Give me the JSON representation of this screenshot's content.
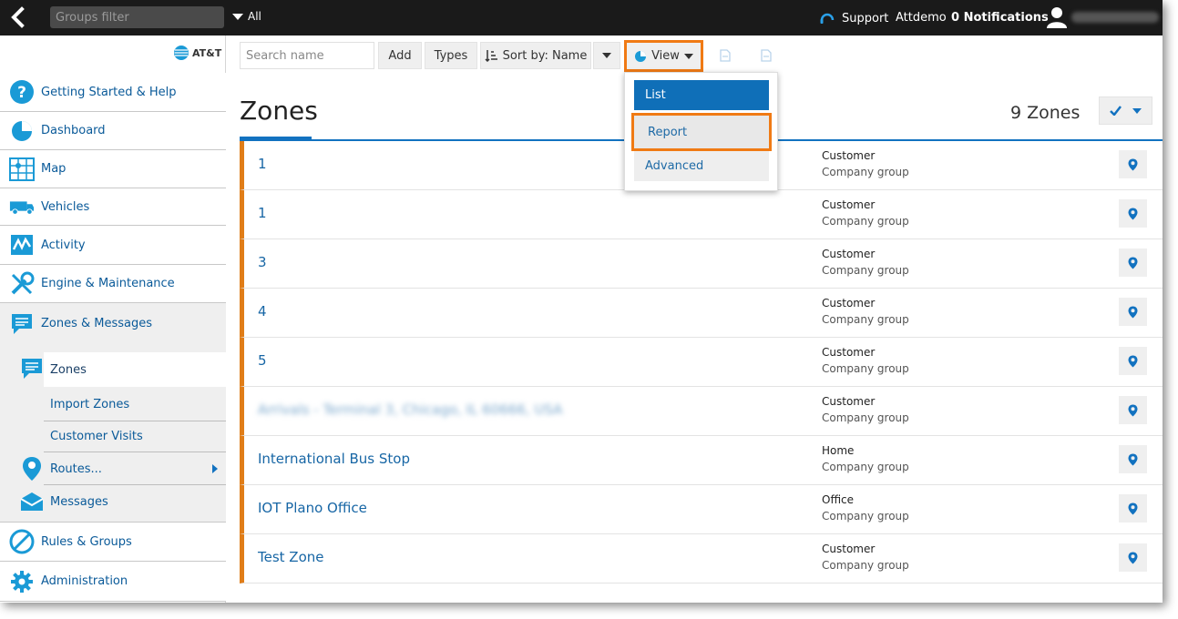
{
  "topbar": {
    "groups_filter_placeholder": "Groups filter",
    "all_label": "All",
    "support_label": "Support",
    "account_name": "Attdemo",
    "notifications_label": "0 Notifications"
  },
  "sidebar": {
    "brand": "AT&T",
    "items": [
      {
        "label": "Getting Started & Help",
        "icon": "help-icon"
      },
      {
        "label": "Dashboard",
        "icon": "dashboard-icon"
      },
      {
        "label": "Map",
        "icon": "map-icon"
      },
      {
        "label": "Vehicles",
        "icon": "vehicles-icon"
      },
      {
        "label": "Activity",
        "icon": "activity-icon"
      },
      {
        "label": "Engine & Maintenance",
        "icon": "wrench-icon"
      },
      {
        "label": "Zones & Messages",
        "icon": "message-icon"
      },
      {
        "label": "Rules & Groups",
        "icon": "rules-icon"
      },
      {
        "label": "Administration",
        "icon": "gear-icon"
      }
    ],
    "submenu": [
      {
        "label": "Zones",
        "icon": "zones-icon"
      },
      {
        "label": "Import Zones"
      },
      {
        "label": "Customer Visits"
      },
      {
        "label": "Routes...",
        "icon": "pin-icon"
      },
      {
        "label": "Messages",
        "icon": "envelope-icon"
      }
    ]
  },
  "toolbar": {
    "search_placeholder": "Search name",
    "add_label": "Add",
    "types_label": "Types",
    "sort_label": "Sort by: Name",
    "view_label": "View"
  },
  "view_menu": {
    "list": "List",
    "report": "Report",
    "advanced": "Advanced"
  },
  "main": {
    "title": "Zones",
    "count_label": "9 Zones"
  },
  "zones": [
    {
      "name": "1",
      "type": "Customer",
      "group": "Company group",
      "blurred": false
    },
    {
      "name": "1",
      "type": "Customer",
      "group": "Company group",
      "blurred": false
    },
    {
      "name": "3",
      "type": "Customer",
      "group": "Company group",
      "blurred": false
    },
    {
      "name": "4",
      "type": "Customer",
      "group": "Company group",
      "blurred": false
    },
    {
      "name": "5",
      "type": "Customer",
      "group": "Company group",
      "blurred": false
    },
    {
      "name": "Arrivals - Terminal 3, Chicago, IL 60666, USA",
      "type": "Customer",
      "group": "Company group",
      "blurred": true
    },
    {
      "name": "International Bus Stop",
      "type": "Home",
      "group": "Company group",
      "blurred": false
    },
    {
      "name": "IOT Plano Office",
      "type": "Office",
      "group": "Company group",
      "blurred": false
    },
    {
      "name": "Test Zone",
      "type": "Customer",
      "group": "Company group",
      "blurred": false
    }
  ],
  "colors": {
    "accent": "#1272c0",
    "highlight": "#f07a14",
    "row_marker": "#e07d18",
    "topbar": "#1a1a1a"
  }
}
